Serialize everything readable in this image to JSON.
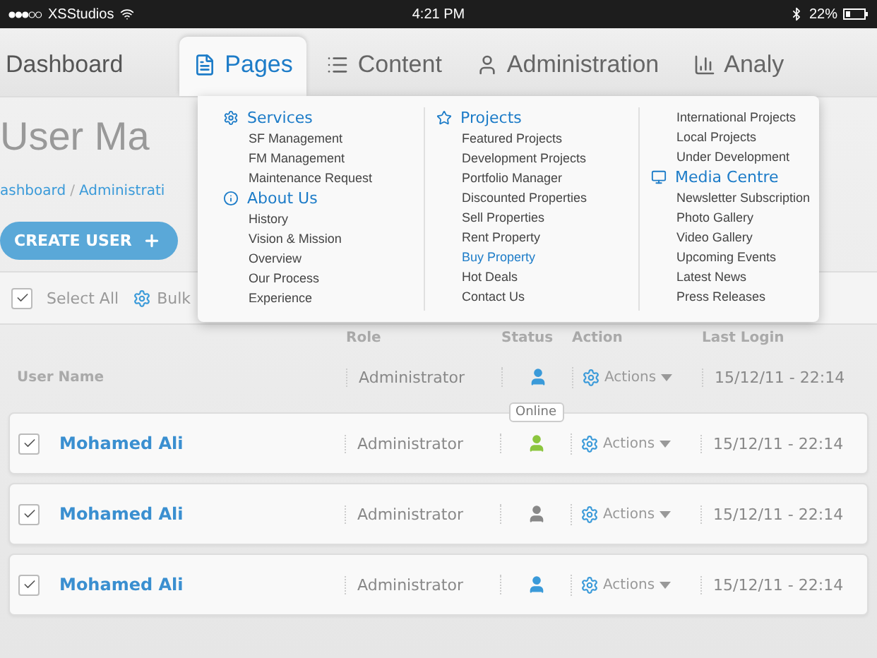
{
  "status_bar": {
    "carrier": "XSStudios",
    "time": "4:21 PM",
    "battery": "22%"
  },
  "nav": {
    "home": "Dashboard",
    "tabs": [
      {
        "label": "Pages",
        "kind": "page",
        "selected": true
      },
      {
        "label": "Content",
        "kind": "list",
        "selected": false
      },
      {
        "label": "Administration",
        "kind": "user",
        "selected": false
      },
      {
        "label": "Analy",
        "kind": "chart",
        "selected": false
      }
    ]
  },
  "page": {
    "title": "User Ma",
    "breadcrumb": [
      "ashboard",
      "Administrati"
    ],
    "breadcrumb_separator": "/",
    "create_button": "CREATE USER"
  },
  "mega_menu": {
    "columns": [
      {
        "groups": [
          {
            "title": "Services",
            "kind": "gear",
            "items": [
              {
                "label": "SF Management",
                "selected": false
              },
              {
                "label": "FM Management",
                "selected": false
              },
              {
                "label": "Maintenance Request",
                "selected": false
              }
            ]
          },
          {
            "title": "About Us",
            "kind": "info",
            "items": [
              {
                "label": "History",
                "selected": false
              },
              {
                "label": "Vision & Mission",
                "selected": false
              },
              {
                "label": "Overview",
                "selected": false
              },
              {
                "label": "Our Process",
                "selected": false
              },
              {
                "label": "Experience",
                "selected": false
              }
            ]
          }
        ]
      },
      {
        "groups": [
          {
            "title": "Projects",
            "kind": "star",
            "items": [
              {
                "label": "Featured Projects",
                "selected": false
              },
              {
                "label": "Development Projects",
                "selected": false
              },
              {
                "label": "Portfolio Manager",
                "selected": false
              },
              {
                "label": "Discounted Properties",
                "selected": false
              },
              {
                "label": "Sell Properties",
                "selected": false
              },
              {
                "label": "Rent Property",
                "selected": false
              },
              {
                "label": "Buy Property",
                "selected": true
              },
              {
                "label": "Hot Deals",
                "selected": false
              },
              {
                "label": "Contact Us",
                "selected": false
              }
            ]
          }
        ]
      },
      {
        "groups": [
          {
            "items": [
              {
                "label": "International Projects",
                "selected": false
              },
              {
                "label": "Local Projects",
                "selected": false
              },
              {
                "label": "Under Development",
                "selected": false
              }
            ]
          },
          {
            "title": "Media Centre",
            "kind": "monitor",
            "items": [
              {
                "label": "Newsletter Subscription",
                "selected": false
              },
              {
                "label": "Photo Gallery",
                "selected": false
              },
              {
                "label": "Video Gallery",
                "selected": false
              },
              {
                "label": "Upcoming Events",
                "selected": false
              },
              {
                "label": "Latest News",
                "selected": false
              },
              {
                "label": "Press Releases",
                "selected": false
              }
            ]
          }
        ]
      }
    ]
  },
  "table": {
    "select_all": {
      "label": "Select All",
      "checked": true
    },
    "bulk": "Bulk",
    "columns": [
      "Role",
      "Status",
      "Action",
      "Last Login"
    ],
    "rows": [
      {
        "kind": "heading",
        "label": "User Name",
        "role": "Administrator",
        "color": "#3a9ad9",
        "action": "Actions",
        "last_login": "15/12/11 - 22:14"
      },
      {
        "kind": "user",
        "name": "Mohamed Ali",
        "checked": true,
        "role": "Administrator",
        "color": "#8cc63f",
        "tooltip": "Online",
        "action": "Actions",
        "last_login": "15/12/11 - 22:14"
      },
      {
        "kind": "user",
        "name": "Mohamed Ali",
        "checked": true,
        "role": "Administrator",
        "color": "#888888",
        "action": "Actions",
        "last_login": "15/12/11 - 22:14"
      },
      {
        "kind": "user",
        "name": "Mohamed Ali",
        "checked": true,
        "role": "Administrator",
        "color": "#3a9ad9",
        "action": "Actions",
        "last_login": "15/12/11 - 22:14"
      }
    ]
  }
}
